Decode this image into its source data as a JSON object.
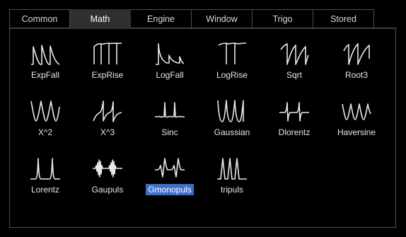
{
  "tabs": [
    {
      "label": "Common",
      "active": false
    },
    {
      "label": "Math",
      "active": true
    },
    {
      "label": "Engine",
      "active": false
    },
    {
      "label": "Window",
      "active": false
    },
    {
      "label": "Trigo",
      "active": false
    },
    {
      "label": "Stored",
      "active": false
    }
  ],
  "waveforms": [
    {
      "label": "ExpFall",
      "icon": "exp-fall-icon",
      "selected": false
    },
    {
      "label": "ExpRise",
      "icon": "exp-rise-icon",
      "selected": false
    },
    {
      "label": "LogFall",
      "icon": "log-fall-icon",
      "selected": false
    },
    {
      "label": "LogRise",
      "icon": "log-rise-icon",
      "selected": false
    },
    {
      "label": "Sqrt",
      "icon": "sqrt-icon",
      "selected": false
    },
    {
      "label": "Root3",
      "icon": "root3-icon",
      "selected": false
    },
    {
      "label": "X^2",
      "icon": "x-squared-icon",
      "selected": false
    },
    {
      "label": "X^3",
      "icon": "x-cubed-icon",
      "selected": false
    },
    {
      "label": "Sinc",
      "icon": "sinc-icon",
      "selected": false
    },
    {
      "label": "Gaussian",
      "icon": "gaussian-icon",
      "selected": false
    },
    {
      "label": "Dlorentz",
      "icon": "dlorentz-icon",
      "selected": false
    },
    {
      "label": "Haversine",
      "icon": "haversine-icon",
      "selected": false
    },
    {
      "label": "Lorentz",
      "icon": "lorentz-icon",
      "selected": false
    },
    {
      "label": "Gaupuls",
      "icon": "gaupuls-icon",
      "selected": false
    },
    {
      "label": "Gmonopuls",
      "icon": "gmonopuls-icon",
      "selected": true
    },
    {
      "label": "tripuls",
      "icon": "tripuls-icon",
      "selected": false
    }
  ],
  "colors": {
    "background": "#000000",
    "active_tab": "#303030",
    "selection": "#3d6fc7",
    "waveform_stroke": "#e8e8e8"
  }
}
